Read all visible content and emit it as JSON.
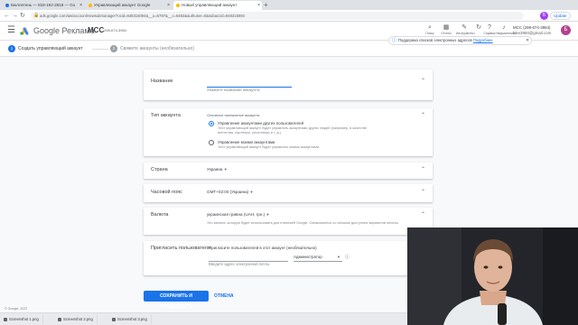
{
  "browser": {
    "tabs": [
      {
        "title": "Бюллетень — 818-192-2819 — Go",
        "favicon_color": "#1a73e8"
      },
      {
        "title": "Управляющий аккаунт Google",
        "favicon_color": "#fbbc04"
      },
      {
        "title": "Новый управляющий аккаунт",
        "favicon_color": "#fbbc04"
      }
    ],
    "new_tab": "+",
    "url": "ads.google.com/aw/account/newsubmanager?ocid=848315094&__u=6787&__c=6482&authuser=0&subaccid=848315094",
    "update_label": "Update",
    "profile_initial": "Б"
  },
  "ads_header": {
    "brand": "Google Реклама",
    "account_type": "MCC",
    "account_id": "298-674-3984",
    "tools": [
      {
        "icon": "search-icon",
        "glyph": "🔍",
        "label": "Поиск"
      },
      {
        "icon": "reports-icon",
        "glyph": "▦",
        "label": "Отчеты"
      },
      {
        "icon": "tools-icon",
        "glyph": "🔧",
        "label": "Инструменты"
      },
      {
        "icon": "refresh-icon",
        "glyph": "↻",
        "label": ""
      },
      {
        "icon": "help-icon",
        "glyph": "?",
        "label": "Справка"
      },
      {
        "icon": "bell-icon",
        "glyph": "🔔",
        "label": "Уведомления"
      }
    ],
    "account_line1": "MCC (298-674-3984)",
    "account_line2": "lake3984@gmail.com",
    "avatar_initial": "Б"
  },
  "steps": {
    "step1": {
      "num": "1",
      "label": "Создать управляющий аккаунт"
    },
    "step2": {
      "num": "2",
      "label": "Свяжите аккаунты (необязательно)"
    }
  },
  "notice": {
    "text": "Поддержка списков электронных адресов",
    "link": "Подробнее"
  },
  "form": {
    "name": {
      "label": "Название",
      "placeholder": "Укажите название аккаунта"
    },
    "account_type": {
      "label": "Тип аккаунта",
      "sub": "Основное назначение аккаунта",
      "options": [
        {
          "title": "Управление аккаунтами других пользователей",
          "desc": "Этот управляющий аккаунт будет управлять аккаунтами других людей (например, в качестве агентства, партнеры, реселлеры и т. д.)",
          "selected": true
        },
        {
          "title": "Управление моими аккаунтами",
          "desc": "Этот управляющий аккаунт будет управлять моими аккаунтами.",
          "selected": false
        }
      ]
    },
    "country": {
      "label": "Страна",
      "value": "Украина"
    },
    "timezone": {
      "label": "Часовой пояс",
      "value": "GMT+02:00 (Украина)"
    },
    "currency": {
      "label": "Валюта",
      "value": "украинская гривна (UAH, грн.)",
      "note": "Это валюта, которую будет использовать для платежей Google. Ознакомьтесь со списком доступных вариантов оплаты."
    },
    "invite": {
      "label": "Пригласить пользователя",
      "heading": "Пригласите пользователей в этот аккаунт (необязательно)",
      "email_placeholder": "Введите адрес электронной почты",
      "role": "Администратор"
    },
    "save": "СОХРАНИТЬ И ПРОДОЛЖИТЬ",
    "cancel": "ОТМЕНА"
  },
  "footer": "© Google, 2022",
  "downloads": [
    {
      "name": "Screenshot 1.png"
    },
    {
      "name": "Screenshot 2.png"
    },
    {
      "name": "Screenshot 3.png"
    }
  ],
  "colors": {
    "accent": "#1a73e8",
    "step_inactive": "#5f6368",
    "avatar": "#b0438b"
  }
}
